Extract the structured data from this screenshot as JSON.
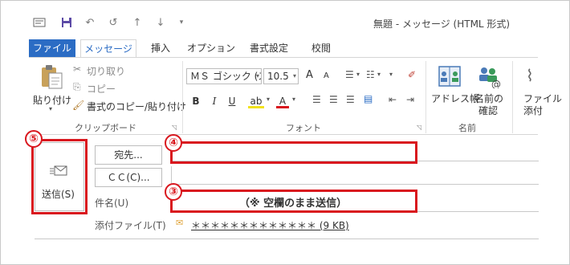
{
  "window": {
    "title": "無題 - メッセージ (HTML 形式)"
  },
  "quick_access": [
    "save-icon",
    "undo-icon",
    "redo-icon",
    "up-icon",
    "down-icon",
    "customize-icon"
  ],
  "tabs": [
    {
      "label": "ファイル"
    },
    {
      "label": "メッセージ"
    },
    {
      "label": "挿入"
    },
    {
      "label": "オプション"
    },
    {
      "label": "書式設定"
    },
    {
      "label": "校閲"
    }
  ],
  "ribbon": {
    "clipboard": {
      "paste_label": "貼り付け",
      "cut_label": "切り取り",
      "copy_label": "コピー",
      "format_painter_label": "書式のコピー/貼り付け",
      "group_label": "クリップボード"
    },
    "font": {
      "font_name": "ＭＳ ゴシック (ス",
      "font_size": "10.5",
      "bold": "B",
      "italic": "I",
      "underline": "U",
      "highlight": "ab",
      "font_color": "A",
      "grow": "A",
      "shrink": "A",
      "group_label": "フォント"
    },
    "names": {
      "address_book_label": "アドレス帳",
      "check_names_label1": "名前の",
      "check_names_label2": "確認",
      "group_label": "名前"
    },
    "include": {
      "attach_file_label1": "ファイル",
      "attach_file_label2": "添付"
    }
  },
  "compose": {
    "send_label": "送信(S)",
    "to_button": "宛先...",
    "cc_button": "ＣＣ(C)...",
    "subject_label": "件名(U)",
    "subject_value": "（※ 空欄のまま送信）",
    "attachment_label": "添付ファイル(T)",
    "attachment_value": "＊＊＊＊＊＊＊＊＊＊＊＊＊ (9 KB)"
  },
  "callouts": [
    "⑤",
    "④",
    "③"
  ],
  "colors": {
    "accent": "#2b6cc4",
    "callout": "#d9171e"
  }
}
